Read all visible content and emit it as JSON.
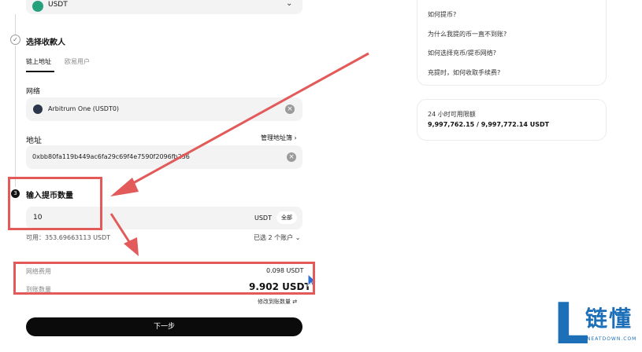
{
  "coin": {
    "symbol": "USDT"
  },
  "steps": {
    "recipient_title": "选择收款人",
    "amount_title": "输入提币数量",
    "amount_step_number": "3"
  },
  "recipient_tabs": [
    {
      "label": "链上地址",
      "active": true
    },
    {
      "label": "欧易用户",
      "active": false
    }
  ],
  "network": {
    "label": "网络",
    "value": "Arbitrum One (USDT0)"
  },
  "address": {
    "label": "地址",
    "manage_label": "管理地址簿",
    "value": "0xbb80fa119b449ac6fa29c69f4e7590f2096fb256"
  },
  "amount": {
    "value": "10",
    "unit": "USDT",
    "all_label": "全部",
    "available_text": "可用：353.69663113 USDT",
    "selected_accounts": "已选 2 个账户"
  },
  "fees": {
    "network_fee_label": "网络费用",
    "network_fee_value": "0.098 USDT",
    "received_label": "到账数量",
    "received_value": "9.902 USDT",
    "edit_received_label": "修改到账数量"
  },
  "next_button": "下一步",
  "faq": [
    "如何提币?",
    "为什么我提的币一直不到账?",
    "如何选择充币/提币网络?",
    "充提时，如何收取手续费?"
  ],
  "limit": {
    "title": "24 小时可用限额",
    "value": "9,997,762.15 / 9,997,772.14 USDT"
  },
  "watermark": {
    "logo_letter": "L",
    "brand": "链懂",
    "url": "NEATDOWN.COM"
  },
  "colors": {
    "annotation_red": "#e35a5a",
    "logo_blue": "#1d6fb8",
    "usdt_green": "#26a17b"
  }
}
